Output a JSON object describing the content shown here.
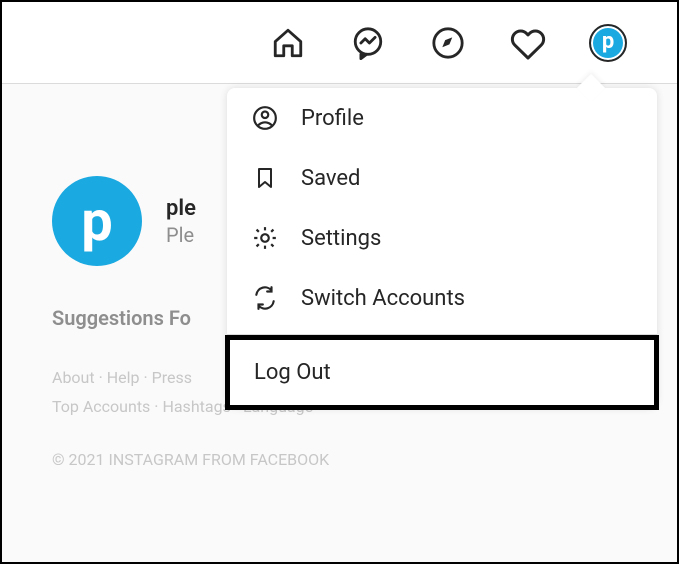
{
  "nav": {
    "avatar_letter": "p"
  },
  "profile": {
    "avatar_letter": "p",
    "username_visible": "ple",
    "fullname_visible": "Ple"
  },
  "suggestions_label": "Suggestions Fo",
  "footer": {
    "links_row1": [
      "About",
      "Help",
      "Press"
    ],
    "links_row2": [
      "Top Accounts",
      "Hashtags",
      "Language"
    ],
    "copyright": "© 2021 INSTAGRAM FROM FACEBOOK"
  },
  "dropdown": {
    "items": [
      {
        "label": "Profile"
      },
      {
        "label": "Saved"
      },
      {
        "label": "Settings"
      },
      {
        "label": "Switch Accounts"
      }
    ],
    "logout_label": "Log Out"
  }
}
